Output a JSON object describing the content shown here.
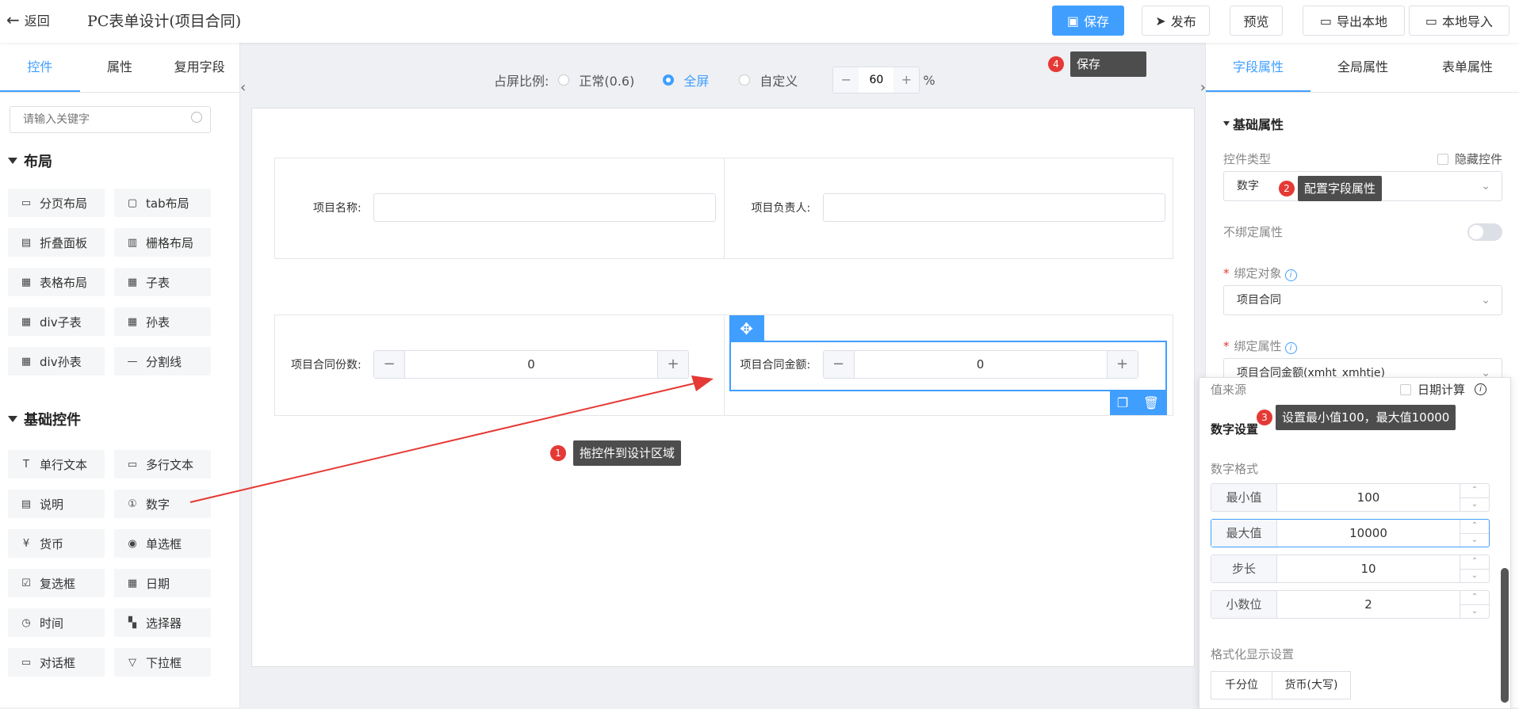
{
  "header": {
    "back_label": "返回",
    "title": "PC表单设计(项目合同)",
    "save": "保存",
    "publish": "发布",
    "preview": "预览",
    "export": "导出本地",
    "import": "本地导入"
  },
  "left": {
    "tabs": [
      "控件",
      "属性",
      "复用字段"
    ],
    "search_placeholder": "请输入关键字",
    "layout_title": "布局",
    "layout_items": [
      {
        "label": "分页布局",
        "icon": "page-layout-icon"
      },
      {
        "label": "tab布局",
        "icon": "tab-layout-icon"
      },
      {
        "label": "折叠面板",
        "icon": "collapse-panel-icon"
      },
      {
        "label": "栅格布局",
        "icon": "grid-layout-icon"
      },
      {
        "label": "表格布局",
        "icon": "table-layout-icon"
      },
      {
        "label": "子表",
        "icon": "subtable-icon"
      },
      {
        "label": "div子表",
        "icon": "div-subtable-icon"
      },
      {
        "label": "孙表",
        "icon": "grandchild-table-icon"
      },
      {
        "label": "div孙表",
        "icon": "div-grandchild-table-icon"
      },
      {
        "label": "分割线",
        "icon": "divider-icon"
      }
    ],
    "basic_title": "基础控件",
    "basic_items": [
      {
        "label": "单行文本",
        "icon": "single-text-icon"
      },
      {
        "label": "多行文本",
        "icon": "multi-text-icon"
      },
      {
        "label": "说明",
        "icon": "description-icon"
      },
      {
        "label": "数字",
        "icon": "number-icon"
      },
      {
        "label": "货币",
        "icon": "currency-icon"
      },
      {
        "label": "单选框",
        "icon": "radio-icon"
      },
      {
        "label": "复选框",
        "icon": "checkbox-icon"
      },
      {
        "label": "日期",
        "icon": "calendar-icon"
      },
      {
        "label": "时间",
        "icon": "clock-icon"
      },
      {
        "label": "选择器",
        "icon": "selector-icon"
      },
      {
        "label": "对话框",
        "icon": "dialog-icon"
      },
      {
        "label": "下拉框",
        "icon": "dropdown-icon"
      }
    ]
  },
  "center": {
    "ratio_label": "占屏比例:",
    "opt_normal": "正常(0.6)",
    "opt_full": "全屏",
    "opt_custom": "自定义",
    "zoom_value": "60",
    "zoom_unit": "%",
    "fields": {
      "project_name": "项目名称:",
      "project_owner": "项目负责人:",
      "contract_count": "项目合同份数:",
      "contract_count_value": "0",
      "contract_amount": "项目合同金额:",
      "contract_amount_value": "0"
    },
    "tip1": "拖控件到设计区域",
    "tip4": "保存"
  },
  "right": {
    "tabs": [
      "字段属性",
      "全局属性",
      "表单属性"
    ],
    "basic_attr": "基础属性",
    "control_type_label": "控件类型",
    "hide_control": "隐藏控件",
    "control_type_value": "数字",
    "tip2": "配置字段属性",
    "unbind_label": "不绑定属性",
    "bind_object_label": "绑定对象",
    "bind_object_value": "项目合同",
    "bind_attr_label": "绑定属性",
    "bind_attr_value": "项目合同金额(xmht_xmhtje)"
  },
  "float": {
    "value_source": "值来源",
    "date_calc": "日期计算",
    "tip3": "设置最小值100，最大值10000",
    "number_settings": "数字设置",
    "number_format": "数字格式",
    "min_label": "最小值",
    "min_value": "100",
    "max_label": "最大值",
    "max_value": "10000",
    "step_label": "步长",
    "step_value": "10",
    "decimal_label": "小数位",
    "decimal_value": "2",
    "display_format": "格式化显示设置",
    "thousands": "千分位",
    "currency_upper": "货币(大写)"
  },
  "badges": [
    "1",
    "2",
    "3",
    "4"
  ],
  "colors": {
    "accent": "#409eff",
    "tooltip": "#4d4d4d",
    "badge": "#e53935"
  }
}
